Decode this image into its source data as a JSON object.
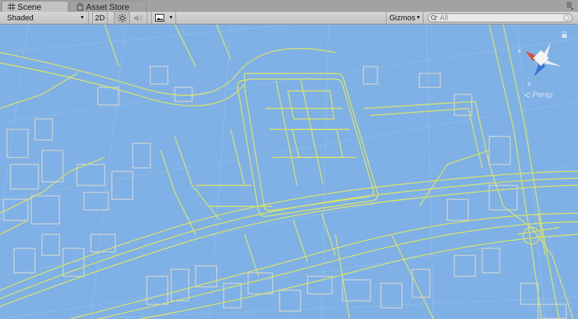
{
  "tabs": [
    {
      "label": "Scene",
      "icon": "grid-icon",
      "active": true
    },
    {
      "label": "Asset Store",
      "icon": "store-bag-icon",
      "active": false
    }
  ],
  "toolbar": {
    "draw_mode": "Shaded",
    "mode_2d": "2D",
    "lighting_icon": "sun-icon",
    "audio_icon": "speaker-icon",
    "effects_icon": "image-icon",
    "gizmos_label": "Gizmos",
    "search_placeholder": "All"
  },
  "scene": {
    "projection_label": "Persp",
    "gizmo_axes": [
      "x",
      "z"
    ],
    "background_color": "#7fb1e6",
    "line_color": "#d8e36a",
    "footprint_color": "#d3d6d0"
  }
}
